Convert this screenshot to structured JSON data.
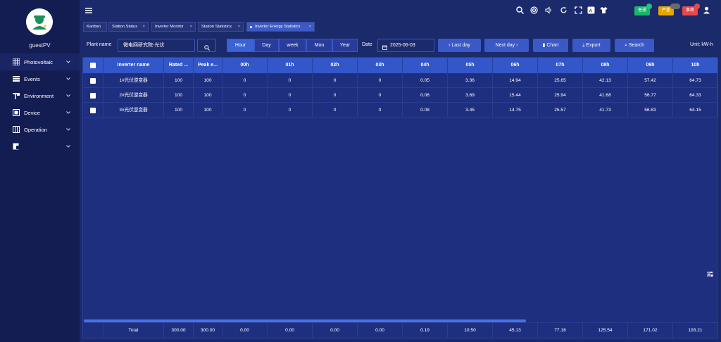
{
  "sidebar": {
    "username": "guestPV",
    "items": [
      {
        "label": "Photovoltaic",
        "icon": "grid-panel-icon"
      },
      {
        "label": "Events",
        "icon": "list-icon"
      },
      {
        "label": "Environment",
        "icon": "wind-turbine-icon"
      },
      {
        "label": "Device",
        "icon": "device-box-icon"
      },
      {
        "label": "Operation",
        "icon": "calendar-grid-icon"
      },
      {
        "label": "",
        "icon": "document-icon"
      }
    ]
  },
  "topbar": {
    "icons": [
      "search-icon",
      "life-ring-icon",
      "volume-icon",
      "refresh-icon",
      "fullscreen-icon",
      "translate-icon",
      "theme-shirt-icon"
    ],
    "badges": [
      {
        "label": "普通",
        "color": "#19b56a",
        "dot": "#21c27a"
      },
      {
        "label": "严重",
        "color": "#e6a400",
        "dot": "#6b6b6b"
      },
      {
        "label": "事故",
        "color": "#e5484d",
        "dot": "#e5484d"
      }
    ],
    "user_icon": "user-icon"
  },
  "tabs": [
    {
      "label": "Kanban",
      "closable": false,
      "active": false
    },
    {
      "label": "Station Status",
      "closable": true,
      "active": false
    },
    {
      "label": "Inverter Monitor",
      "closable": true,
      "active": false
    },
    {
      "label": "Station Statistics",
      "closable": true,
      "active": false
    },
    {
      "label": "Inverter Energy Statistics",
      "closable": true,
      "active": true
    }
  ],
  "filter": {
    "plant_label": "Plant name",
    "plant_value": "微电网研究院-光伏",
    "periods": [
      "Hour",
      "Day",
      "week",
      "Mon",
      "Year"
    ],
    "active_period": "Hour",
    "date_label": "Date",
    "date_value": "2025-06-03",
    "last_day": "Last day",
    "next_day": "Next day",
    "chart": "Chart",
    "export": "Export",
    "search": "Search",
    "unit": "Unit:  kW·h"
  },
  "table": {
    "headers": [
      "Inverter name",
      "Rated ...",
      "Peak e...",
      "00h",
      "01h",
      "02h",
      "03h",
      "04h",
      "05h",
      "06h",
      "07h",
      "08h",
      "09h",
      "10h"
    ],
    "rows": [
      [
        "1#光伏逆变器",
        "100",
        "100",
        "0",
        "0",
        "0",
        "0",
        "0.05",
        "3.36",
        "14.94",
        "25.65",
        "42.13",
        "57.42",
        "64.73"
      ],
      [
        "2#光伏逆变器",
        "100",
        "100",
        "0",
        "0",
        "0",
        "0",
        "0.06",
        "3.69",
        "15.44",
        "25.94",
        "41.68",
        "56.77",
        "64.33"
      ],
      [
        "3#光伏逆变器",
        "100",
        "100",
        "0",
        "0",
        "0",
        "0",
        "0.08",
        "3.45",
        "14.75",
        "25.57",
        "41.73",
        "56.83",
        "64.15"
      ]
    ],
    "total": [
      "Total",
      "300.00",
      "300.00",
      "0.00",
      "0.00",
      "0.00",
      "0.00",
      "0.19",
      "10.50",
      "45.13",
      "77.16",
      "125.54",
      "171.02",
      "193.21"
    ]
  }
}
